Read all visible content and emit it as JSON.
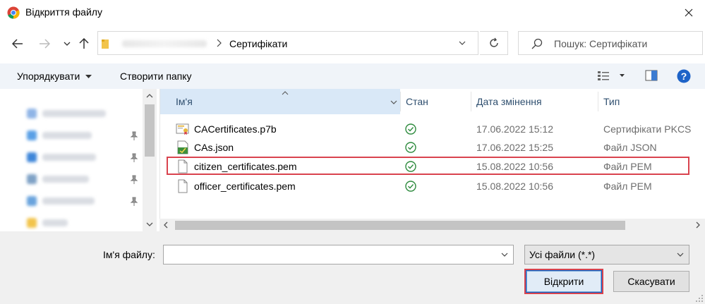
{
  "window": {
    "title": "Відкриття файлу",
    "icon": "chrome-icon",
    "close_icon": "close-icon"
  },
  "navbar": {
    "back_icon": "arrow-left-icon",
    "forward_icon": "arrow-right-icon",
    "recent_icon": "chevron-down-icon",
    "up_icon": "arrow-up-icon",
    "address_folder": "Сертифікати",
    "refresh_icon": "refresh-icon",
    "search_placeholder": "Пошук: Сертифікати"
  },
  "toolbar": {
    "organize_label": "Упорядкувати",
    "new_folder_label": "Створити папку",
    "view_icon": "view-list-icon",
    "preview_icon": "preview-pane-icon",
    "help_icon": "help-icon"
  },
  "columns": {
    "name": "Ім'я",
    "status": "Стан",
    "date": "Дата змінення",
    "type": "Тип"
  },
  "files": [
    {
      "name": "CACertificates.p7b",
      "icon": "certificate-file-icon",
      "status_icon": "synced-check-icon",
      "date": "17.06.2022 15:12",
      "type": "Сертифікати PKCS"
    },
    {
      "name": "CAs.json",
      "icon": "json-file-icon",
      "status_icon": "synced-check-icon",
      "date": "17.06.2022 15:25",
      "type": "Файл JSON"
    },
    {
      "name": "citizen_certificates.pem",
      "icon": "blank-file-icon",
      "status_icon": "synced-check-icon",
      "date": "15.08.2022 10:56",
      "type": "Файл PEM"
    },
    {
      "name": "officer_certificates.pem",
      "icon": "blank-file-icon",
      "status_icon": "synced-check-icon",
      "date": "15.08.2022 10:56",
      "type": "Файл PEM"
    }
  ],
  "bottom": {
    "filename_label": "Ім'я файлу:",
    "filename_value": "",
    "filter_value": "Усі файли (*.*)",
    "open_label": "Відкрити",
    "cancel_label": "Скасувати"
  },
  "colors": {
    "accent": "#0a64c8",
    "highlight_box": "#d9434e",
    "status_green": "#2e8b3e",
    "selected_header": "#d9e8f7"
  }
}
